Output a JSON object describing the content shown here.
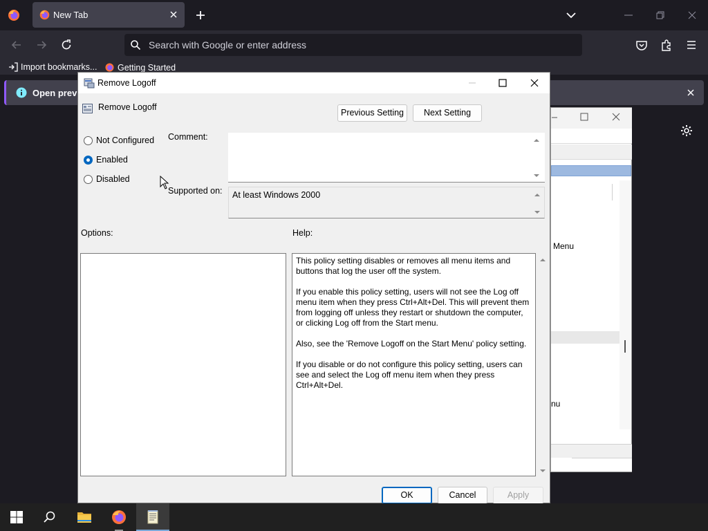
{
  "browser": {
    "tab": {
      "title": "New Tab"
    },
    "urlbar": {
      "placeholder": "Search with Google or enter address"
    },
    "bookmarks": [
      {
        "label": "Import bookmarks..."
      },
      {
        "label": "Getting Started"
      }
    ],
    "notice": {
      "text": "Open previo"
    }
  },
  "background_window": {
    "texts": [
      "Menu",
      "nu"
    ]
  },
  "dialog": {
    "title": "Remove Logoff",
    "policy_name": "Remove Logoff",
    "previous_button": "Previous Setting",
    "next_button": "Next Setting",
    "radios": [
      {
        "label": "Not Configured",
        "checked": false
      },
      {
        "label": "Enabled",
        "checked": true
      },
      {
        "label": "Disabled",
        "checked": false
      }
    ],
    "comment_label": "Comment:",
    "comment_value": "",
    "supported_label": "Supported on:",
    "supported_value": "At least Windows 2000",
    "options_label": "Options:",
    "help_label": "Help:",
    "help_paragraphs": [
      "This policy setting disables or removes all menu items and buttons that log the user off the system.",
      "If you enable this policy setting, users will not see the Log off menu item when they press Ctrl+Alt+Del. This will prevent them from logging off unless they restart or shutdown the computer, or clicking Log off from the Start menu.",
      "Also, see the 'Remove Logoff on the Start Menu' policy setting.",
      "If you disable or do not configure this policy setting, users can see and select the Log off menu item when they press Ctrl+Alt+Del."
    ],
    "ok_button": "OK",
    "cancel_button": "Cancel",
    "apply_button": "Apply"
  },
  "taskbar": {
    "items": [
      "start-icon",
      "search-icon",
      "file-explorer-icon",
      "firefox-icon",
      "notepad-icon"
    ]
  }
}
